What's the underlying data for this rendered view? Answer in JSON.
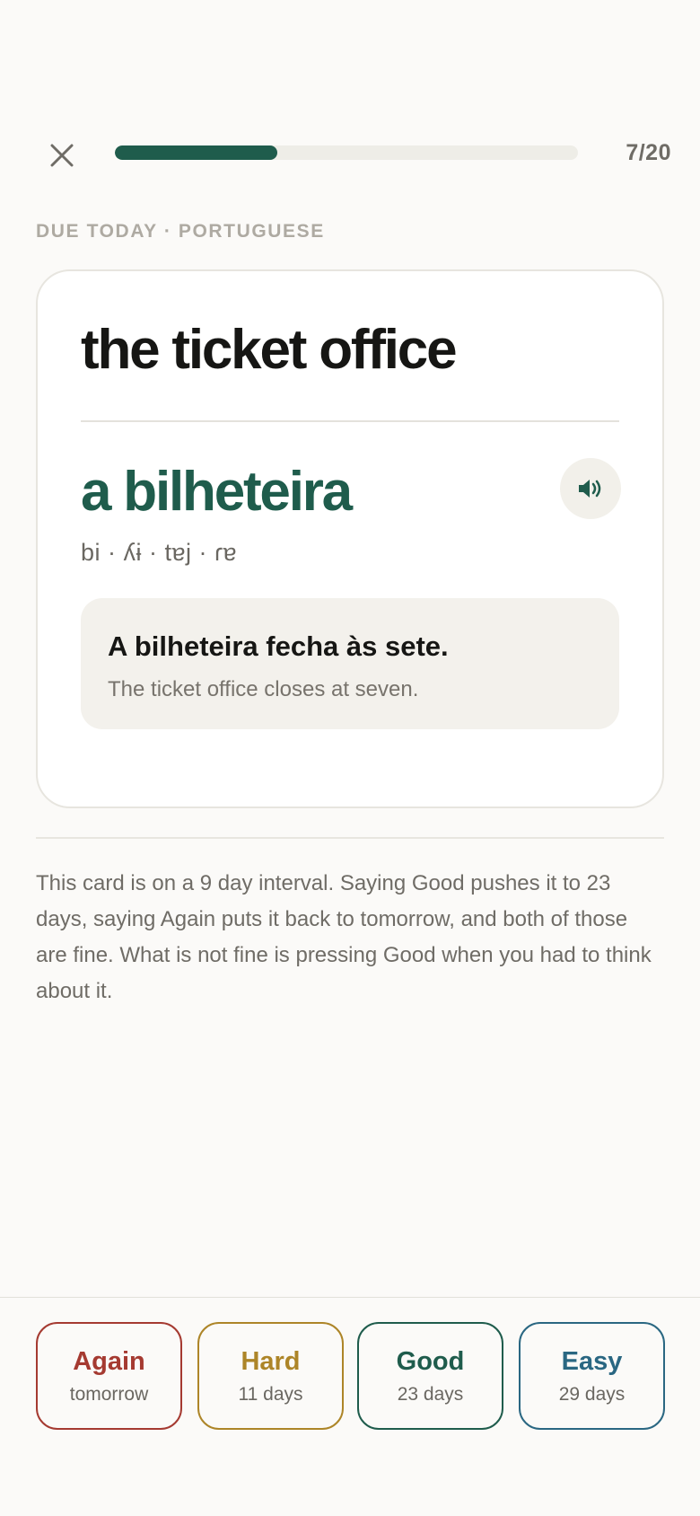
{
  "header": {
    "progress_text": "7/20",
    "progress_fraction": 0.35,
    "deck_label": "DUE TODAY · PORTUGUESE"
  },
  "card": {
    "prompt": "the ticket office",
    "answer": "a bilheteira",
    "ipa": "bi · ʎɨ · tɐj · ɾɐ",
    "example_pt": "A bilheteira fecha às sete.",
    "example_en": "The ticket office closes at seven."
  },
  "hint": "This card is on a 9 day interval. Saying Good pushes it to 23 days, saying Again puts it back to tomorrow, and both of those are fine. What is not fine is pressing Good when you had to think about it.",
  "grades": {
    "again": {
      "label": "Again",
      "interval": "tomorrow"
    },
    "hard": {
      "label": "Hard",
      "interval": "11 days"
    },
    "good": {
      "label": "Good",
      "interval": "23 days"
    },
    "easy": {
      "label": "Easy",
      "interval": "29 days"
    }
  },
  "icons": {
    "close": "close-icon",
    "audio": "speaker-icon"
  },
  "colors": {
    "accent": "#1f5c4c",
    "again": "#a53a31",
    "hard": "#ad8528",
    "good": "#1f5c4c",
    "easy": "#2a6782"
  }
}
